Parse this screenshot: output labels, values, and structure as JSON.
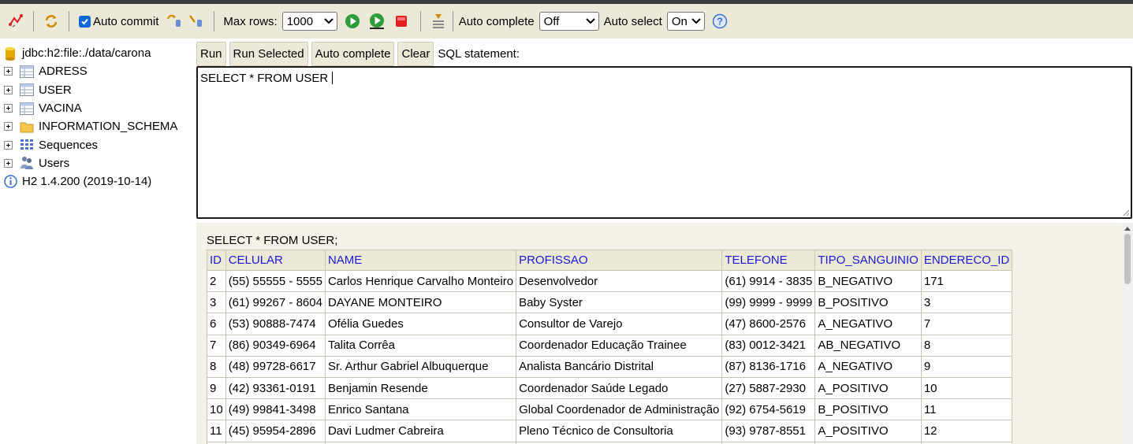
{
  "toolbar": {
    "icons": [
      "disconnect-icon",
      "refresh-icon",
      "commit-icon",
      "rollback-icon",
      "run-icon",
      "run-selected-icon",
      "stop-icon",
      "history-icon",
      "help-icon"
    ],
    "auto_commit_label": "Auto commit",
    "auto_commit_checked": true,
    "max_rows_label": "Max rows:",
    "max_rows_value": "1000",
    "auto_complete_label": "Auto complete",
    "auto_complete_value": "Off",
    "auto_select_label": "Auto select",
    "auto_select_value": "On",
    "help_glyph": "?"
  },
  "sidebar": {
    "connection": "jdbc:h2:file:./data/carona",
    "items": [
      {
        "label": "ADRESS",
        "icon": "table-icon"
      },
      {
        "label": "USER",
        "icon": "table-icon"
      },
      {
        "label": "VACINA",
        "icon": "table-icon"
      },
      {
        "label": "INFORMATION_SCHEMA",
        "icon": "folder-icon"
      },
      {
        "label": "Sequences",
        "icon": "sequences-icon"
      },
      {
        "label": "Users",
        "icon": "users-icon"
      }
    ],
    "version": "H2 1.4.200 (2019-10-14)"
  },
  "sql_toolbar": {
    "run": "Run",
    "run_selected": "Run Selected",
    "auto_complete": "Auto complete",
    "clear": "Clear",
    "label": "SQL statement:"
  },
  "editor": {
    "text": "SELECT * FROM USER"
  },
  "results": {
    "query": "SELECT * FROM USER;",
    "columns": [
      "ID",
      "CELULAR",
      "NAME",
      "PROFISSAO",
      "TELEFONE",
      "TIPO_SANGUINIO",
      "ENDERECO_ID"
    ],
    "rows": [
      [
        "2",
        "(55) 55555 - 5555",
        "Carlos Henrique Carvalho Monteiro",
        "Desenvolvedor",
        "(61) 9914 - 3835",
        "B_NEGATIVO",
        "171"
      ],
      [
        "3",
        "(61) 99267 - 8604",
        "DAYANE MONTEIRO",
        "Baby Syster",
        "(99) 9999 - 9999",
        "B_POSITIVO",
        "3"
      ],
      [
        "6",
        "(53) 90888-7474",
        "Ofélia Guedes",
        "Consultor de Varejo",
        "(47) 8600-2576",
        "A_NEGATIVO",
        "7"
      ],
      [
        "7",
        "(86) 90349-6964",
        "Talita Corrêa",
        "Coordenador Educação Trainee",
        "(83) 0012-3421",
        "AB_NEGATIVO",
        "8"
      ],
      [
        "8",
        "(48) 99728-6617",
        "Sr. Arthur Gabriel Albuquerque",
        "Analista Bancário Distrital",
        "(87) 8136-1716",
        "A_NEGATIVO",
        "9"
      ],
      [
        "9",
        "(42) 93361-0191",
        "Benjamin Resende",
        "Coordenador Saúde Legado",
        "(27) 5887-2930",
        "A_POSITIVO",
        "10"
      ],
      [
        "10",
        "(49) 99841-3498",
        "Enrico Santana",
        "Global Coordenador de Administração",
        "(92) 6754-5619",
        "B_POSITIVO",
        "11"
      ],
      [
        "11",
        "(45) 95954-2896",
        "Davi Ludmer Cabreira",
        "Pleno Técnico de Consultoria",
        "(93) 9787-8551",
        "A_POSITIVO",
        "12"
      ],
      [
        "",
        "",
        "",
        "",
        "",
        "",
        ""
      ]
    ]
  },
  "colors": {
    "toolbar_bg": "#ece9d8",
    "results_bg": "#f4f2e8",
    "header_text": "#1a1add",
    "checkbox": "#0b68d6"
  }
}
